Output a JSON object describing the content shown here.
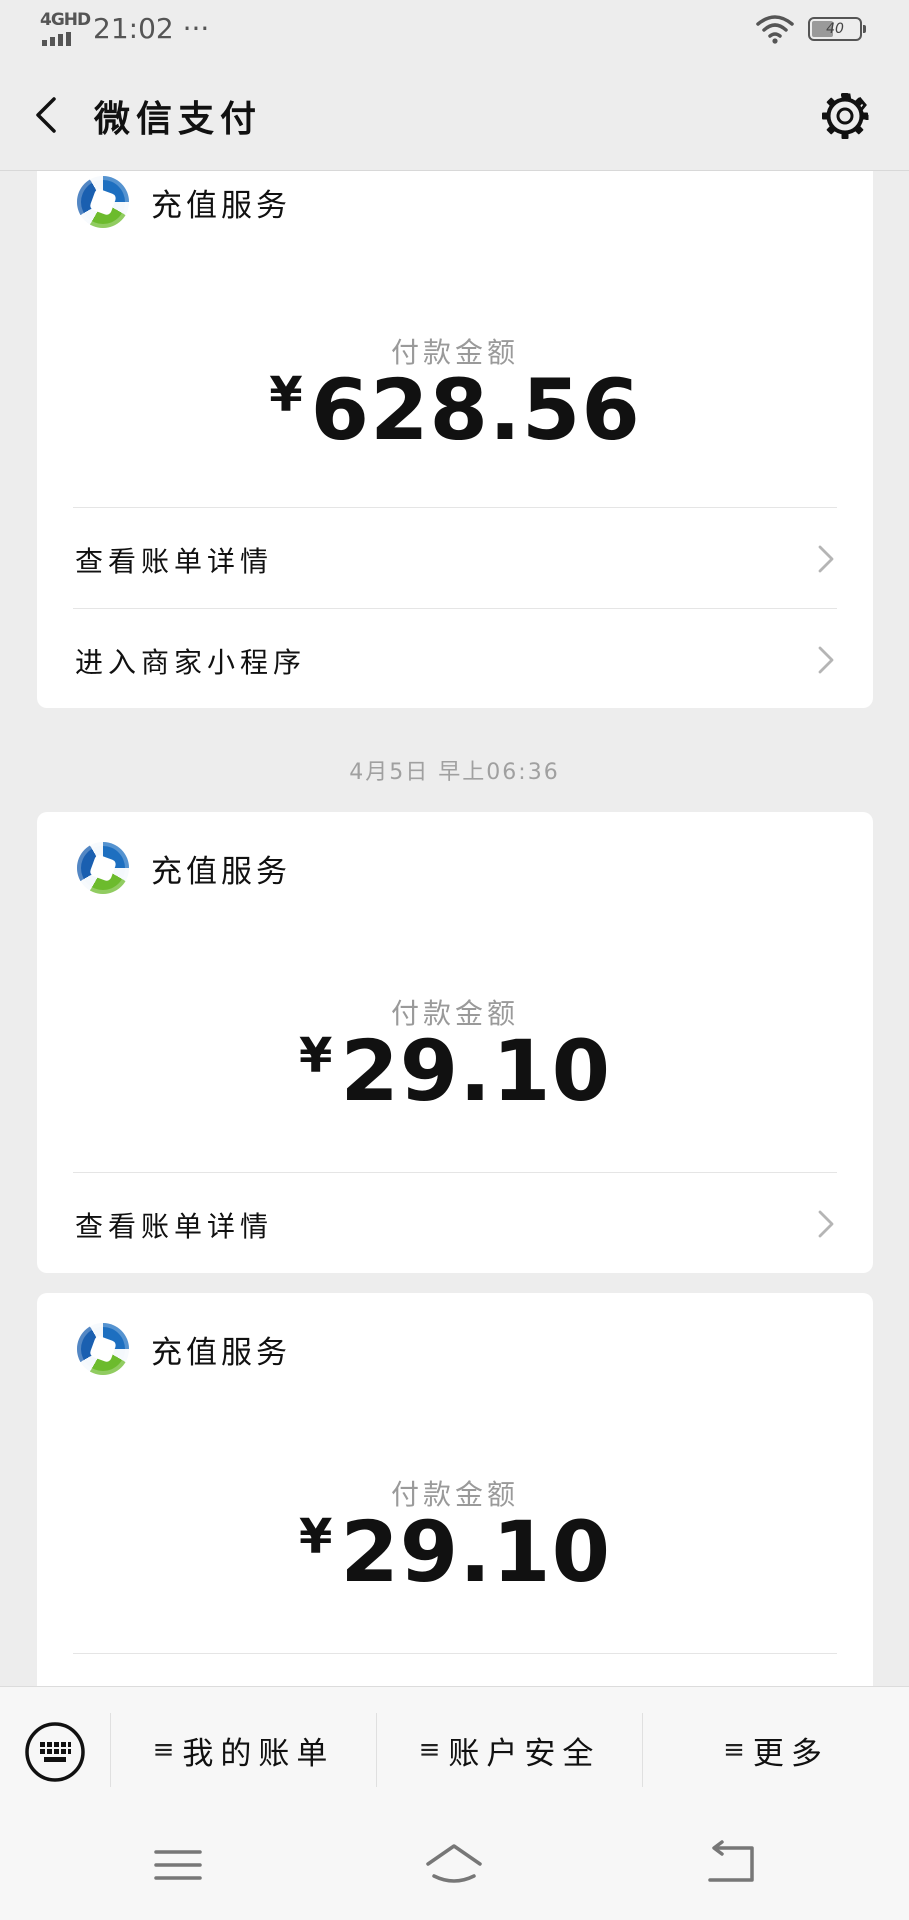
{
  "status": {
    "network": "4GHD",
    "time": "21:02 ···",
    "battery": "40"
  },
  "nav": {
    "title": "微信支付"
  },
  "cards": [
    {
      "merchant": "充值服务",
      "amount_label": "付款金额",
      "currency": "¥",
      "amount": "628.56",
      "rows": [
        "查看账单详情",
        "进入商家小程序"
      ]
    },
    {
      "merchant": "充值服务",
      "amount_label": "付款金额",
      "currency": "¥",
      "amount": "29.10",
      "rows": [
        "查看账单详情"
      ]
    },
    {
      "merchant": "充值服务",
      "amount_label": "付款金额",
      "currency": "¥",
      "amount": "29.10",
      "rows": []
    }
  ],
  "timestamp": "4月5日 早上06:36",
  "menu": {
    "icon_glyph": "≡",
    "items": [
      "我的账单",
      "账户安全",
      "更多"
    ]
  },
  "icons": {
    "back": "chevron-left-icon",
    "settings": "gear-icon",
    "merchant_logo": "merchant-logo-icon",
    "row_arrow": "chevron-right-icon",
    "keyboard": "keyboard-icon",
    "sys_menu": "menu-lines-icon",
    "sys_home": "home-icon",
    "sys_back": "back-arrow-icon"
  }
}
